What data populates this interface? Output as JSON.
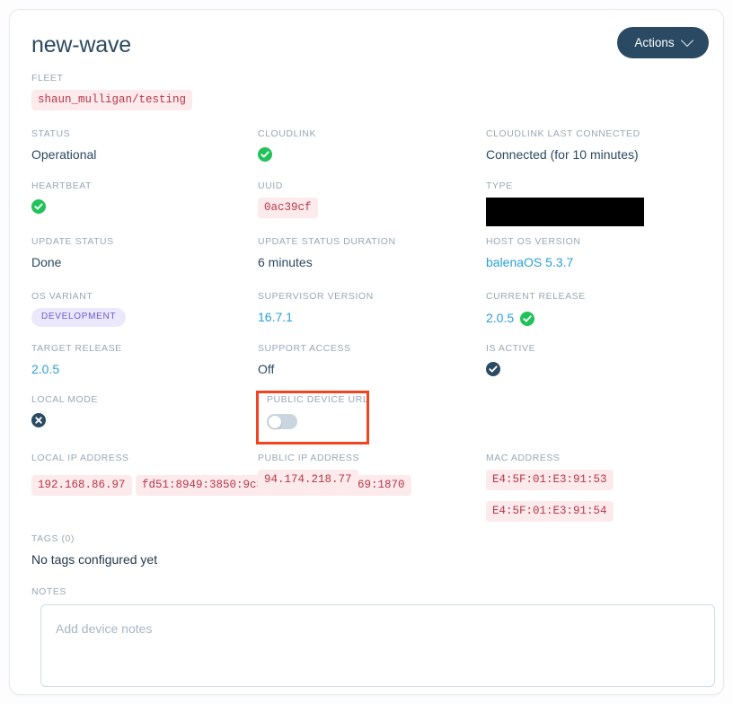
{
  "header": {
    "title": "new-wave",
    "actions_label": "Actions",
    "chevron_icon": "chevron-down-icon"
  },
  "fleet": {
    "label": "FLEET",
    "value": "shaun_mulligan/testing"
  },
  "fields": [
    {
      "key": "status",
      "label": "STATUS",
      "value": "Operational",
      "kind": "text"
    },
    {
      "key": "cloudlink",
      "label": "CLOUDLINK",
      "value": "",
      "kind": "icon-check-green"
    },
    {
      "key": "cloudlink_last",
      "label": "CLOUDLINK LAST CONNECTED",
      "value": "Connected (for 10 minutes)",
      "kind": "text"
    },
    {
      "key": "heartbeat",
      "label": "HEARTBEAT",
      "value": "",
      "kind": "icon-check-green"
    },
    {
      "key": "uuid",
      "label": "UUID",
      "value": "0ac39cf",
      "kind": "code"
    },
    {
      "key": "type",
      "label": "TYPE",
      "value": "",
      "kind": "redacted"
    },
    {
      "key": "update_status",
      "label": "UPDATE STATUS",
      "value": "Done",
      "kind": "text"
    },
    {
      "key": "update_duration",
      "label": "UPDATE STATUS DURATION",
      "value": "6 minutes",
      "kind": "text"
    },
    {
      "key": "host_os_version",
      "label": "HOST OS VERSION",
      "value": "balenaOS 5.3.7",
      "kind": "link"
    },
    {
      "key": "os_variant",
      "label": "OS VARIANT",
      "value": "DEVELOPMENT",
      "kind": "pill"
    },
    {
      "key": "supervisor_version",
      "label": "SUPERVISOR VERSION",
      "value": "16.7.1",
      "kind": "link"
    },
    {
      "key": "current_release",
      "label": "CURRENT RELEASE",
      "value": "2.0.5",
      "kind": "link-check"
    },
    {
      "key": "target_release",
      "label": "TARGET RELEASE",
      "value": "2.0.5",
      "kind": "link"
    },
    {
      "key": "support_access",
      "label": "SUPPORT ACCESS",
      "value": "Off",
      "kind": "text"
    },
    {
      "key": "is_active",
      "label": "IS ACTIVE",
      "value": "",
      "kind": "icon-check-navy"
    },
    {
      "key": "local_mode",
      "label": "LOCAL MODE",
      "value": "",
      "kind": "icon-x-navy"
    },
    {
      "key": "public_device_url",
      "label": "PUBLIC DEVICE URL",
      "value": "off",
      "kind": "toggle"
    }
  ],
  "addresses": {
    "local_ip": {
      "label": "LOCAL IP ADDRESS",
      "values": [
        "192.168.86.97",
        "fd51:8949:3850:9c3d:84d5:f4ed:8669:1870"
      ]
    },
    "public_ip": {
      "label": "PUBLIC IP ADDRESS",
      "values": [
        "94.174.218.77"
      ]
    },
    "mac": {
      "label": "MAC ADDRESS",
      "values": [
        "E4:5F:01:E3:91:53",
        "E4:5F:01:E3:91:54"
      ]
    }
  },
  "tags": {
    "label": "TAGS (0)",
    "empty_text": "No tags configured yet"
  },
  "notes": {
    "label": "NOTES",
    "placeholder": "Add device notes",
    "value": ""
  },
  "colors": {
    "accent_navy": "#2a4a63",
    "link_blue": "#2a9fd8",
    "status_green": "#21c25a",
    "code_text": "#b4394a",
    "code_bg": "#fdeaec",
    "pill_text": "#6b5bd2",
    "pill_bg": "#ece8fb",
    "annotation_red": "#f1441f"
  }
}
